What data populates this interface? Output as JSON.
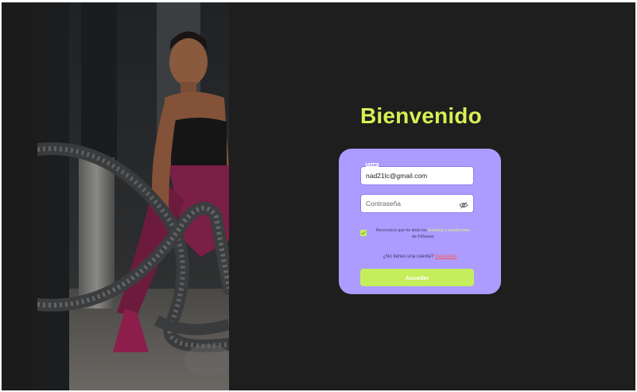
{
  "login": {
    "title": "Bienvenido",
    "email_label": "Email",
    "email_value": "nad21lc@gmail.com",
    "password_placeholder": "Contraseña",
    "password_toggle_icon": "eye-off-icon",
    "terms_prefix": "Reconozco que he leído los",
    "terms_link": "términos y condiciones",
    "terms_suffix": "de FitSense",
    "terms_checked": true,
    "signup_prompt": "¿No tienes una cuenta?",
    "signup_link": "Regístrate",
    "submit_label": "Acceder"
  },
  "colors": {
    "background": "#1e1e1e",
    "title": "#d9ef55",
    "card": "#ad9cff",
    "button": "#c4ee5b",
    "signup_link": "#ff5a4d"
  },
  "hero_image": "woman-training-with-battle-ropes"
}
